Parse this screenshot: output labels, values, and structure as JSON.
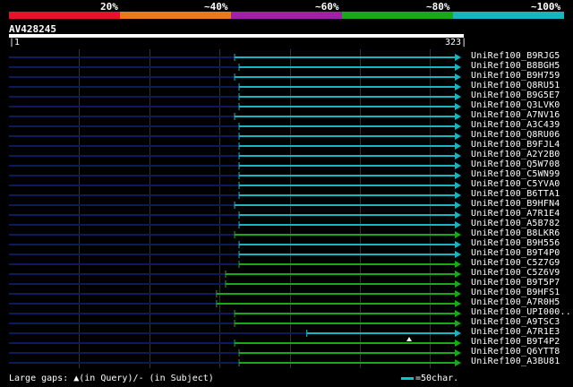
{
  "legend": {
    "colors": [
      "#e8102a",
      "#e87a1c",
      "#a020a8",
      "#18a818",
      "#18b4c0"
    ],
    "labels": [
      "20%",
      "~40%",
      "~60%",
      "~80%",
      "~100%"
    ]
  },
  "query": {
    "id": "AV428245",
    "start": "1",
    "end": "323"
  },
  "rows": [
    {
      "label": "UniRef100_B9RJG5",
      "start": 0.5,
      "color": "#18b4c0"
    },
    {
      "label": "UniRef100_B8BGH5",
      "start": 0.51,
      "color": "#18b4c0"
    },
    {
      "label": "UniRef100_B9H759",
      "start": 0.5,
      "color": "#18b4c0"
    },
    {
      "label": "UniRef100_Q8RU51",
      "start": 0.51,
      "color": "#18b4c0"
    },
    {
      "label": "UniRef100_B9G5E7",
      "start": 0.51,
      "color": "#18b4c0"
    },
    {
      "label": "UniRef100_Q3LVK0",
      "start": 0.51,
      "color": "#18b4c0"
    },
    {
      "label": "UniRef100_A7NV16",
      "start": 0.5,
      "color": "#18b4c0"
    },
    {
      "label": "UniRef100_A3C439",
      "start": 0.51,
      "color": "#18b4c0"
    },
    {
      "label": "UniRef100_Q8RU06",
      "start": 0.51,
      "color": "#18b4c0"
    },
    {
      "label": "UniRef100_B9FJL4",
      "start": 0.51,
      "color": "#18b4c0"
    },
    {
      "label": "UniRef100_A2Y2B0",
      "start": 0.51,
      "color": "#18b4c0"
    },
    {
      "label": "UniRef100_Q5W708",
      "start": 0.51,
      "color": "#18b4c0"
    },
    {
      "label": "UniRef100_C5WN99",
      "start": 0.51,
      "color": "#18b4c0"
    },
    {
      "label": "UniRef100_C5YVA0",
      "start": 0.51,
      "color": "#18b4c0"
    },
    {
      "label": "UniRef100_B6TTA1",
      "start": 0.51,
      "color": "#18b4c0"
    },
    {
      "label": "UniRef100_B9HFN4",
      "start": 0.5,
      "color": "#18b4c0"
    },
    {
      "label": "UniRef100_A7R1E4",
      "start": 0.51,
      "color": "#18b4c0"
    },
    {
      "label": "UniRef100_A5B782",
      "start": 0.51,
      "color": "#18b4c0"
    },
    {
      "label": "UniRef100_B8LKR6",
      "start": 0.5,
      "color": "#18a818"
    },
    {
      "label": "UniRef100_B9H556",
      "start": 0.51,
      "color": "#18b4c0"
    },
    {
      "label": "UniRef100_B9T4P0",
      "start": 0.51,
      "color": "#18b4c0"
    },
    {
      "label": "UniRef100_C5Z7G9",
      "start": 0.51,
      "color": "#18a818"
    },
    {
      "label": "UniRef100_C5Z6V9",
      "start": 0.48,
      "color": "#18a818"
    },
    {
      "label": "UniRef100_B9T5P7",
      "start": 0.48,
      "color": "#18a818"
    },
    {
      "label": "UniRef100_B9HFS1",
      "start": 0.46,
      "color": "#18a818"
    },
    {
      "label": "UniRef100_A7R0H5",
      "start": 0.46,
      "color": "#18a818"
    },
    {
      "label": "UniRef100_UPI000..",
      "start": 0.5,
      "color": "#18a818"
    },
    {
      "label": "UniRef100_A9TSC3",
      "start": 0.5,
      "color": "#18a818"
    },
    {
      "label": "UniRef100_A7R1E3",
      "start": 0.66,
      "color": "#18b4c0"
    },
    {
      "label": "UniRef100_B9T4P2",
      "start": 0.5,
      "color": "#18a818"
    },
    {
      "label": "UniRef100_Q6YTT8",
      "start": 0.51,
      "color": "#18a818"
    },
    {
      "label": "UniRef100_A3BU81",
      "start": 0.51,
      "color": "#18a818"
    }
  ],
  "footer": {
    "gaps_label": "Large gaps: ▲(in Query)/- (in Subject)",
    "scale_label": "=50char."
  }
}
